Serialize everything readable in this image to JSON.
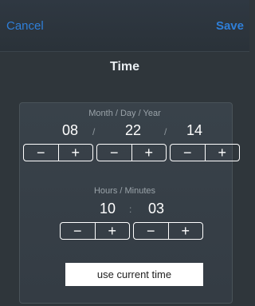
{
  "nav": {
    "cancel_label": "Cancel",
    "save_label": "Save"
  },
  "title": "Time",
  "date": {
    "label": "Month / Day / Year",
    "month": "08",
    "day": "22",
    "year": "14",
    "separator": "/"
  },
  "time": {
    "label": "Hours / Minutes",
    "hours": "10",
    "minutes": "03",
    "separator": ":"
  },
  "stepper": {
    "minus": "−",
    "plus": "+"
  },
  "use_current_time_label": "use current time",
  "colors": {
    "accent": "#2f7fd8",
    "background": "#2f363b"
  }
}
